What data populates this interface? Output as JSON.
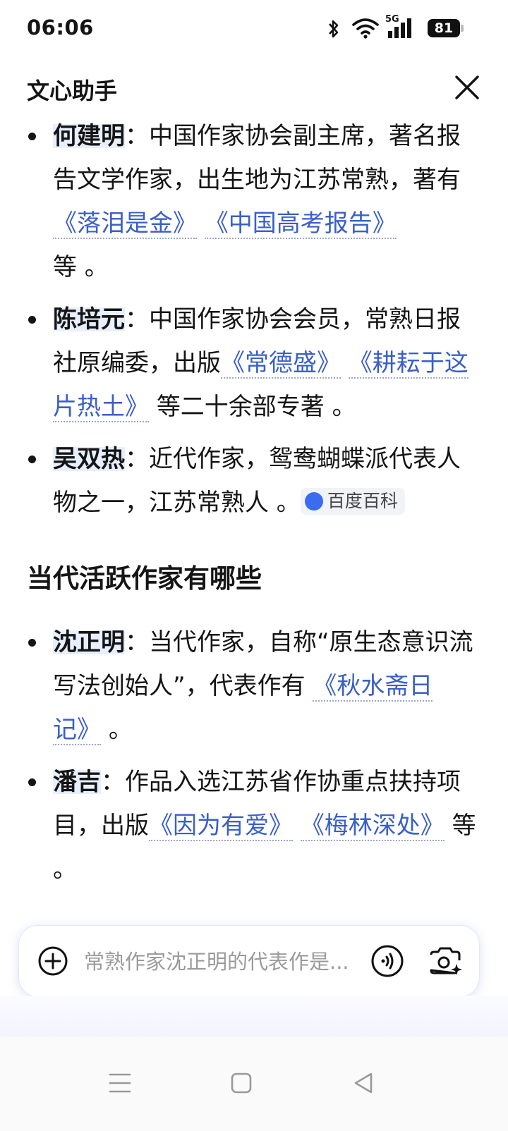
{
  "status": {
    "time": "06:06",
    "battery": "81",
    "network": "5G"
  },
  "header": {
    "title": "文心助手"
  },
  "list1": [
    {
      "name": "何建明",
      "text": "：中国作家协会副主席，著名报告文学作家，出生地为江苏常熟，著有 ",
      "links": [
        "《落泪是金》",
        "《中国高考报告》"
      ],
      "tail": "等 。"
    },
    {
      "name": "陈培元",
      "text": "：中国作家协会会员，常熟日报社原编委，出版",
      "links": [
        "《常德盛》",
        "《耕耘于这片热土》"
      ],
      "tail": "等二十余部专著 。"
    },
    {
      "name": "吴双热",
      "text": "：近代作家，鸳鸯蝴蝶派代表人物之一，江苏常熟人 。",
      "badge": "百度百科"
    }
  ],
  "section_title": "当代活跃作家有哪些",
  "list2": [
    {
      "name": "沈正明",
      "text": "：当代作家，自称“原生态意识流写法创始人”，代表作有 ",
      "links": [
        "《秋水斋日记》"
      ],
      "tail": "。"
    },
    {
      "name": "潘吉",
      "text": "：作品入选江苏省作协重点扶持项目，出版",
      "links": [
        "《因为有爱》",
        "《梅林深处》"
      ],
      "tail": "等 。"
    }
  ],
  "input": {
    "placeholder": "常熟作家沈正明的代表作是..."
  },
  "icons": {
    "plus": "plus-circle-icon",
    "voice": "voice-icon",
    "camera": "camera-icon",
    "close": "close-icon"
  },
  "colors": {
    "link": "#3a5fc8",
    "highlight": "#e8efff",
    "baidu": "#3b6cf0"
  }
}
